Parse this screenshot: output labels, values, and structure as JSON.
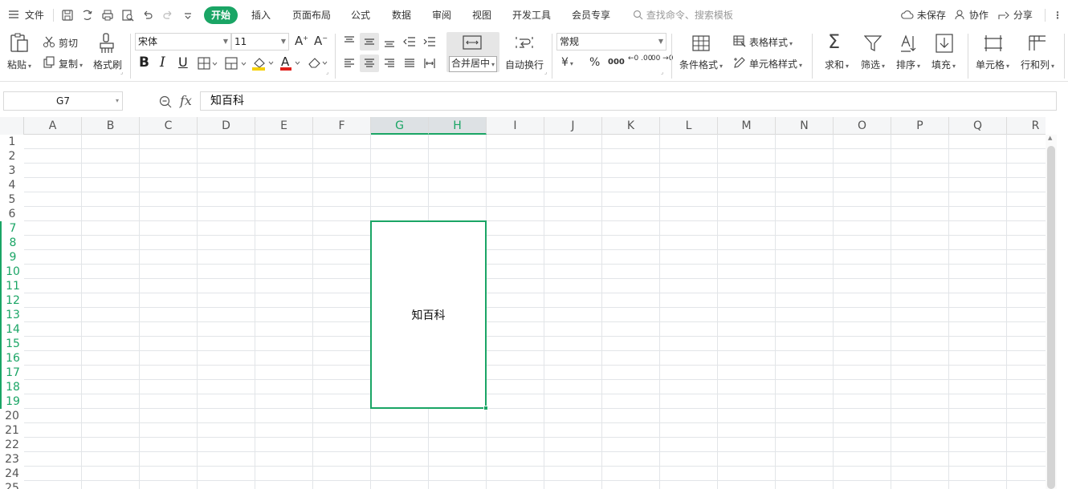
{
  "menu": {
    "file": "文件",
    "tabs": [
      "开始",
      "插入",
      "页面布局",
      "公式",
      "数据",
      "审阅",
      "视图",
      "开发工具",
      "会员专享"
    ],
    "search_placeholder": "查找命令、搜索模板",
    "unsaved": "未保存",
    "collaborate": "协作",
    "share": "分享"
  },
  "ribbon": {
    "paste": "粘贴",
    "cut": "剪切",
    "copy": "复制",
    "format_painter": "格式刷",
    "font_name": "宋体",
    "font_size": "11",
    "bold": "B",
    "italic": "I",
    "underline": "U",
    "font_color_glyph": "A",
    "merge_center": "合并居中",
    "wrap_text": "自动换行",
    "number_format": "常规",
    "currency": "¥",
    "percent": "%",
    "thousands": "000",
    "inc_decimal": "←0 .00",
    "dec_decimal": ".00 →0",
    "conditional_format": "条件格式",
    "table_style": "表格样式",
    "cell_style": "单元格样式",
    "sum": "求和",
    "filter": "筛选",
    "sort": "排序",
    "fill": "填充",
    "cell": "单元格",
    "row_col": "行和列"
  },
  "formula_bar": {
    "name_box": "G7",
    "fx": "fx",
    "content": "知百科"
  },
  "sheet": {
    "columns": [
      "A",
      "B",
      "C",
      "D",
      "E",
      "F",
      "G",
      "H",
      "I",
      "J",
      "K",
      "L",
      "M",
      "N",
      "O",
      "P",
      "Q",
      "R"
    ],
    "rows": [
      "1",
      "2",
      "3",
      "4",
      "5",
      "6",
      "7",
      "8",
      "9",
      "10",
      "11",
      "12",
      "13",
      "14",
      "15",
      "16",
      "17",
      "18",
      "19",
      "20",
      "21",
      "22",
      "23",
      "24",
      "25"
    ],
    "selected_columns": [
      "G",
      "H"
    ],
    "selected_rows_from": 7,
    "selected_rows_to": 19,
    "merged_cell_text": "知百科"
  },
  "colors": {
    "accent": "#1aa565",
    "grid_line": "#e2e5e8",
    "header_bg": "#f5f6f7",
    "fill_color_bar": "#f5d000",
    "font_color_bar": "#e0201b"
  }
}
